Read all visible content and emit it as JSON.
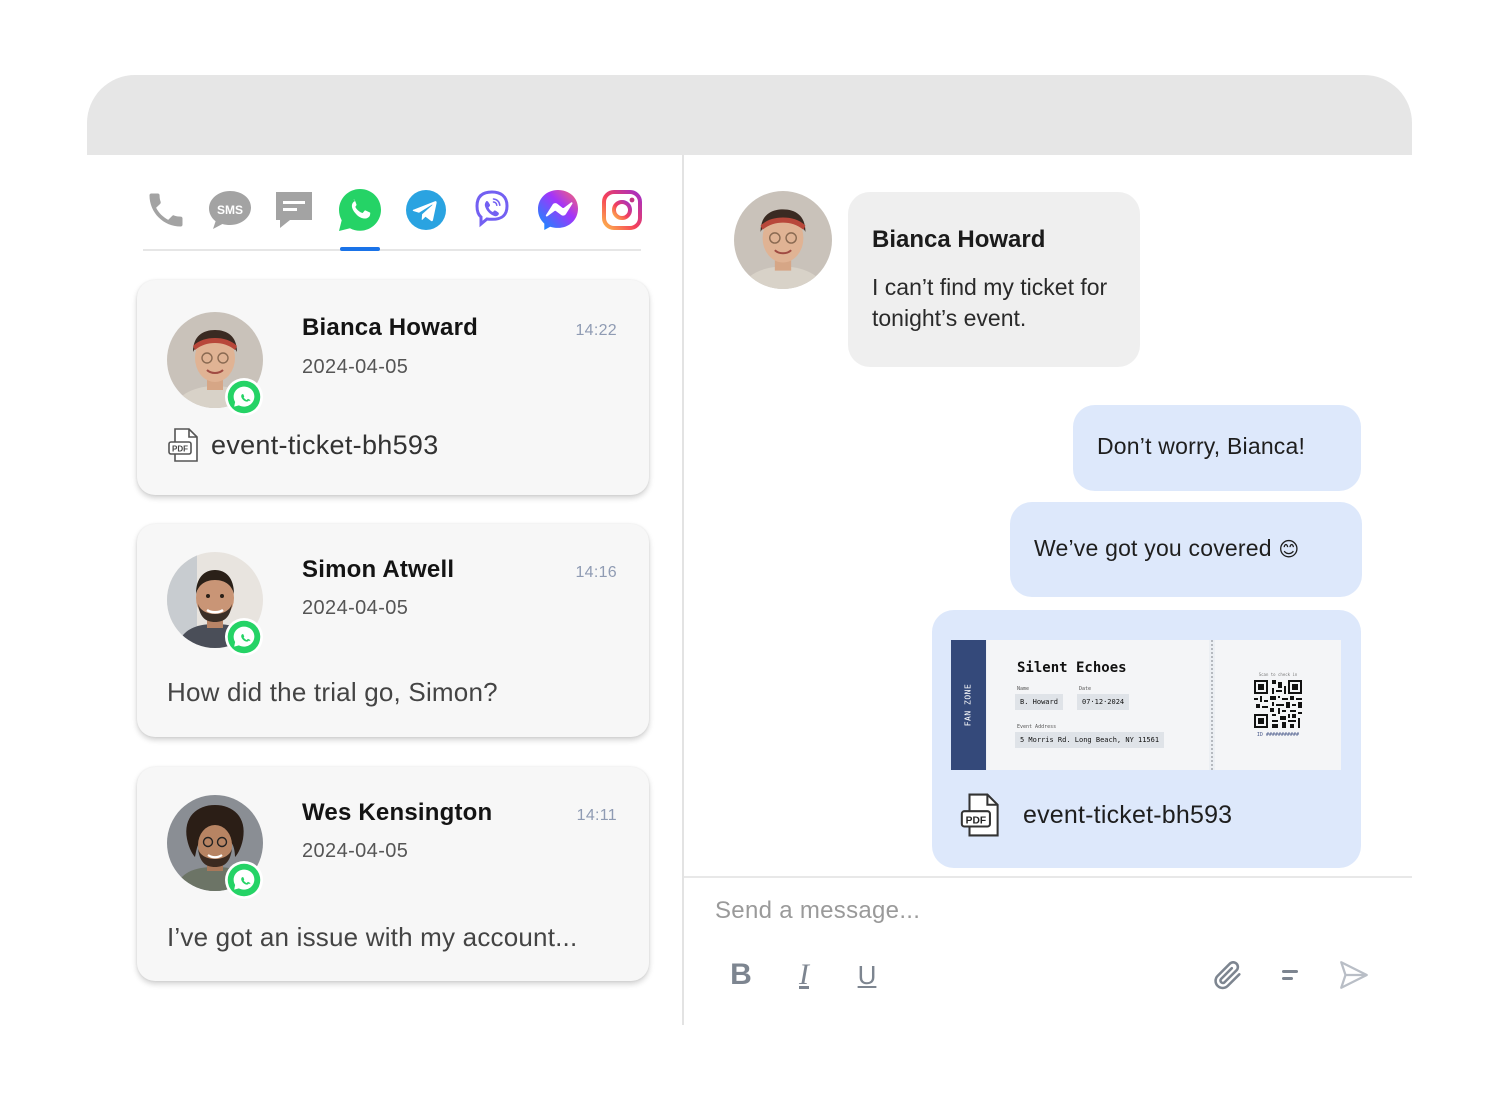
{
  "channels": [
    {
      "name": "phone",
      "icon": "phone-icon",
      "color": "#9e9e9e",
      "active": false
    },
    {
      "name": "sms",
      "icon": "sms-icon",
      "label": "SMS",
      "color": "#9e9e9e",
      "active": false
    },
    {
      "name": "chat",
      "icon": "chat-icon",
      "color": "#9e9e9e",
      "active": false
    },
    {
      "name": "whatsapp",
      "icon": "whatsapp-icon",
      "color": "#25d366",
      "active": true
    },
    {
      "name": "telegram",
      "icon": "telegram-icon",
      "color": "#2aa3e1",
      "active": false
    },
    {
      "name": "viber",
      "icon": "viber-icon",
      "color": "#7360f2",
      "active": false
    },
    {
      "name": "messenger",
      "icon": "messenger-icon",
      "color": "#7b4dff",
      "active": false
    },
    {
      "name": "instagram",
      "icon": "instagram-icon",
      "color": "#e1306c",
      "active": false
    }
  ],
  "conversations": [
    {
      "name": "Bianca Howard",
      "date": "2024-04-05",
      "time": "14:22",
      "preview_type": "file",
      "file_label": "PDF",
      "preview": "event-ticket-bh593",
      "channel": "whatsapp"
    },
    {
      "name": "Simon Atwell",
      "date": "2024-04-05",
      "time": "14:16",
      "preview_type": "text",
      "preview": "How did the trial go, Simon?",
      "channel": "whatsapp"
    },
    {
      "name": "Wes Kensington",
      "date": "2024-04-05",
      "time": "14:11",
      "preview_type": "text",
      "preview": "I’ve got an issue with my account...",
      "channel": "whatsapp"
    }
  ],
  "chat": {
    "incoming": {
      "sender": "Bianca Howard",
      "text": "I can’t find my ticket for tonight’s event."
    },
    "outgoing": [
      {
        "text": "Don’t worry, Bianca!"
      },
      {
        "text": "We’ve got you covered",
        "emoji": "😊"
      }
    ],
    "attachment": {
      "ticket": {
        "stub": "FAN ZONE",
        "title": "Silent Echoes",
        "name_label": "Name",
        "name": "B. Howard",
        "date_label": "Date",
        "date": "07·12·2024",
        "address_label": "Event Address",
        "address": "5 Morris Rd. Long Beach, NY 11561",
        "qr_hint": "Scan to check in",
        "id": "ID ###########"
      },
      "file_label": "PDF",
      "file_name": "event-ticket-bh593"
    }
  },
  "composer": {
    "placeholder": "Send a message...",
    "tools": [
      "bold-icon",
      "italic-icon",
      "underline-icon"
    ],
    "actions": [
      "attach-icon",
      "template-icon",
      "send-icon"
    ],
    "bold_glyph": "B",
    "italic_glyph": "I",
    "underline_glyph": "U"
  },
  "colors": {
    "accent": "#1a73e8",
    "incoming_bubble": "#efefef",
    "outgoing_bubble": "#dde8fb",
    "whatsapp": "#25d366"
  }
}
